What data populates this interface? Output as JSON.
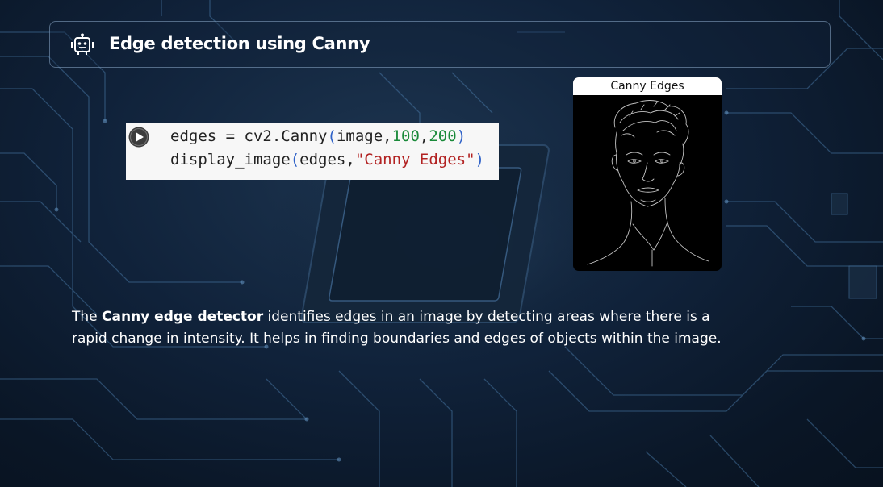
{
  "header": {
    "icon": "robot-icon",
    "title": "Edge detection using Canny"
  },
  "code_cell": {
    "run_icon": "play-circle-icon",
    "line1": {
      "var": "edges",
      "op": " = ",
      "func": "cv2.Canny",
      "open": "(",
      "arg1": "image,",
      "num1": "100",
      "comma": ",",
      "num2": "200",
      "close": ")"
    },
    "line2": {
      "func": "display_image",
      "open": "(",
      "arg1": "edges,",
      "str": "\"Canny Edges\"",
      "close": ")"
    }
  },
  "output_figure": {
    "title": "Canny Edges"
  },
  "description": {
    "prefix": "The ",
    "bold": "Canny edge detector",
    "suffix": " identifies edges in an image by detecting areas where there is a rapid change in intensity.  It helps in finding boundaries and edges of objects within the image."
  },
  "colors": {
    "background": "#10223a",
    "circuit_lines": "#5a8fbf",
    "code_background": "#f7f7f7",
    "code_paren": "#2f62c8",
    "code_number": "#1a8a3a",
    "code_string": "#b22222"
  }
}
